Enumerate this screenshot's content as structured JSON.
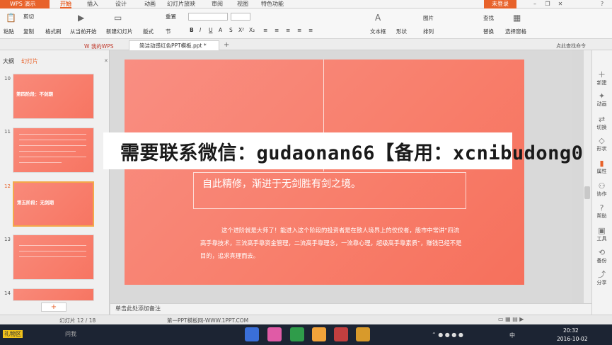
{
  "app": {
    "name": "WPS 演示",
    "login": "未登录"
  },
  "menu": {
    "tabs": [
      "开始",
      "插入",
      "设计",
      "动画",
      "幻灯片放映",
      "审阅",
      "视图",
      "特色功能"
    ],
    "search": "查找"
  },
  "ribbon": {
    "paste": "粘贴",
    "cut": "剪切",
    "copy": "复制",
    "format_painter": "格式刷",
    "from_current": "从当前开始",
    "new_slide": "新建幻灯片",
    "layout": "版式",
    "reset": "重置",
    "section": "节",
    "textbox": "文本框",
    "shape": "形状",
    "picture": "图片",
    "arrange": "排列",
    "find": "查找",
    "replace": "替换",
    "select_pane": "选择窗格"
  },
  "docbar": {
    "my_wps": "我的WPS",
    "doc_title": "简洁动感红色PPT模板.ppt *",
    "feedback": "点此查找命令"
  },
  "leftpane": {
    "tab_outline": "大纲",
    "tab_slides": "幻灯片",
    "slide_numbers": [
      "10",
      "11",
      "12",
      "13",
      "14"
    ],
    "thumb10_title": "第四阶段：不剑期",
    "thumb12_title": "第五阶段：无剑期"
  },
  "slide": {
    "heading": "自此精修，渐进于无剑胜有剑之境。",
    "body": "这个进阶就是大师了！能进入这个阶段的投资者是在散人境界上的佼佼者，般市中常讲“四流高手靠技术，三流高手靠资金管理，二流高手靠理念，一流靠心理，超级高手靠素质”，赚钱已经不是目的，追求真理而去。",
    "banner": "需要联系微信：gudaonan66【备用：xcnibudong0105】"
  },
  "rightpane": {
    "items": [
      "新建",
      "动画",
      "切换",
      "形状",
      "属性",
      "协作",
      "帮助",
      "工具",
      "备份",
      "分享"
    ]
  },
  "notes": {
    "placeholder": "单击此处添加备注"
  },
  "status": {
    "slide_count": "幻灯片 12 / 18",
    "template": "第一PPT模板网-WWW.1PPT.COM"
  },
  "taskbar": {
    "start_label": "礼物区",
    "search_hint": "问我",
    "time": "20:32",
    "date": "2016-10-02",
    "lang": "中"
  },
  "colors": {
    "accent": "#e8622a",
    "slide_bg": "#f8806c",
    "selected_thumb": "#f3a84a"
  }
}
